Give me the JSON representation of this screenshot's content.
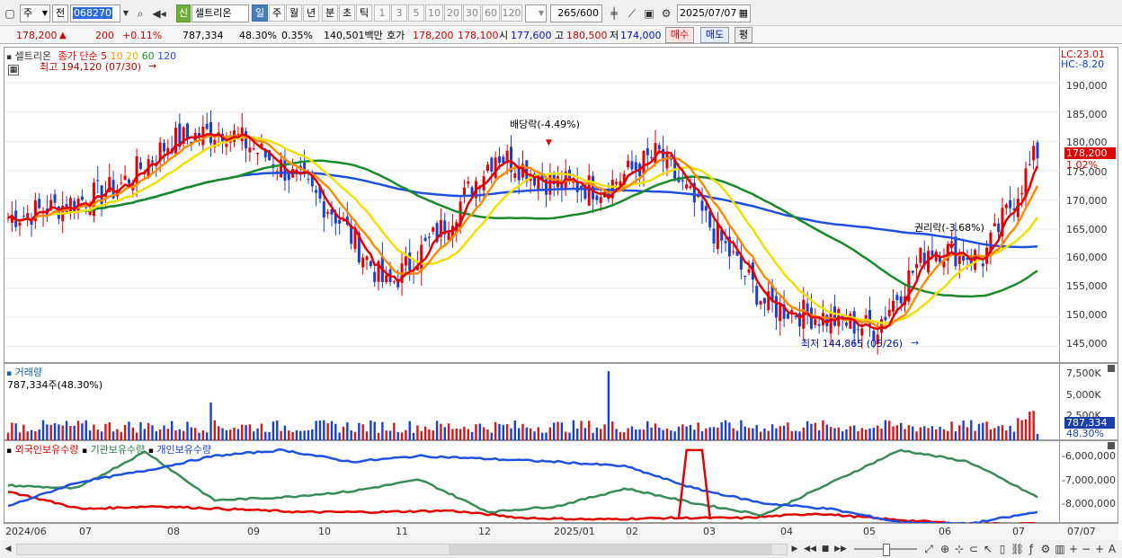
{
  "toolbar": {
    "market": "주",
    "prev": "전",
    "code": "068270",
    "badge": "신",
    "stock_name": "셀트리온",
    "period_day": "일",
    "period_week": "주",
    "period_month": "월",
    "period_year": "년",
    "period_minute": "분",
    "period_second": "초",
    "period_tick": "틱",
    "intervals": [
      "1",
      "3",
      "5",
      "10",
      "20",
      "30",
      "60",
      "120"
    ],
    "count_current": "265",
    "count_total": "/600",
    "date": "2025/07/07"
  },
  "quote": {
    "price": "178,200",
    "up_arrow": "▲",
    "change": "200",
    "change_pct": "+0.11%",
    "volume": "787,334",
    "vol_ratio": "48.30%",
    "turnover": "0.35%",
    "amount": "140,501백만",
    "hoga_label": "호가",
    "ask": "178,200",
    "bid": "178,100",
    "open_label": "시",
    "open": "177,600",
    "high_label": "고",
    "high": "180,500",
    "low_label": "저",
    "low": "174,000",
    "buy_button": "매수",
    "sell_button": "매도",
    "eval_button": "평"
  },
  "price_pane": {
    "name": "셀트리온",
    "ma_label": "종가 단순",
    "ma_periods": [
      "5",
      "10",
      "20",
      "60",
      "120"
    ],
    "ma_colors": [
      "#e00000",
      "#ff8c00",
      "#f0e000",
      "#1a8a2a",
      "#2050e0"
    ],
    "high_note": "최고 194,120 (07/30)",
    "low_note": "최저 144,865 (05/26)",
    "dividend_note": "배당락(-4.49%)",
    "rights_note": "권리락(-3.68%)",
    "lc": "LC:23.01",
    "hc": "HC:-8.20",
    "last_price": "178,200",
    "last_pct": "1.02%",
    "y_ticks": [
      "190,000",
      "185,000",
      "180,000",
      "175,000",
      "170,000",
      "165,000",
      "160,000",
      "155,000",
      "150,000",
      "145,000"
    ]
  },
  "volume_pane": {
    "title": "거래량",
    "value_text": "787,334주(48.30%)",
    "y_ticks": [
      "7,500K",
      "5,000K",
      "2,500K"
    ],
    "last_value": "787,334",
    "last_pct": "48.30%"
  },
  "holders_pane": {
    "legend": [
      "외국인보유수량",
      "기관보유수량",
      "개인보유수량"
    ],
    "legend_colors": [
      "#e00000",
      "#3a8a5a",
      "#2050e0"
    ],
    "y_ticks": [
      "-6,000,000",
      "-7,000,000",
      "-8,000,000"
    ]
  },
  "x_axis": {
    "labels": [
      "2024/06",
      "07",
      "08",
      "09",
      "10",
      "11",
      "12",
      "2025/01",
      "02",
      "03",
      "04",
      "05",
      "06",
      "07"
    ],
    "right_label": "07/07"
  },
  "chart_data": [
    {
      "type": "candlestick",
      "title": "셀트리온",
      "ylim": [
        142000,
        196000
      ],
      "x": [
        "2024/06",
        "07",
        "08",
        "09",
        "10",
        "11",
        "12",
        "2025/01",
        "02",
        "03",
        "04",
        "05",
        "06",
        "07"
      ],
      "close_approx": [
        167000,
        169000,
        172000,
        180000,
        182000,
        176000,
        168000,
        155000,
        165000,
        178000,
        173000,
        172000,
        178000,
        165000,
        152000,
        150000,
        148000,
        162000,
        160000,
        178200
      ],
      "annotations": [
        "최고 194,120 (07/30)",
        "최저 144,865 (05/26)",
        "배당락(-4.49%)",
        "권리락(-3.68%)"
      ],
      "series": [
        {
          "name": "5",
          "color": "#e00000"
        },
        {
          "name": "10",
          "color": "#ff8c00"
        },
        {
          "name": "20",
          "color": "#f0e000"
        },
        {
          "name": "60",
          "color": "#1a8a2a"
        },
        {
          "name": "120",
          "color": "#2050e0"
        }
      ]
    },
    {
      "type": "bar",
      "title": "거래량",
      "ylim": [
        0,
        8000000
      ],
      "last_value": 787334,
      "spike_value": 7600000
    },
    {
      "type": "line",
      "ylim": [
        -8400000,
        -5600000
      ],
      "series": [
        {
          "name": "외국인보유수량",
          "color": "#e00000"
        },
        {
          "name": "기관보유수량",
          "color": "#3a8a5a"
        },
        {
          "name": "개인보유수량",
          "color": "#2050e0"
        }
      ]
    }
  ]
}
